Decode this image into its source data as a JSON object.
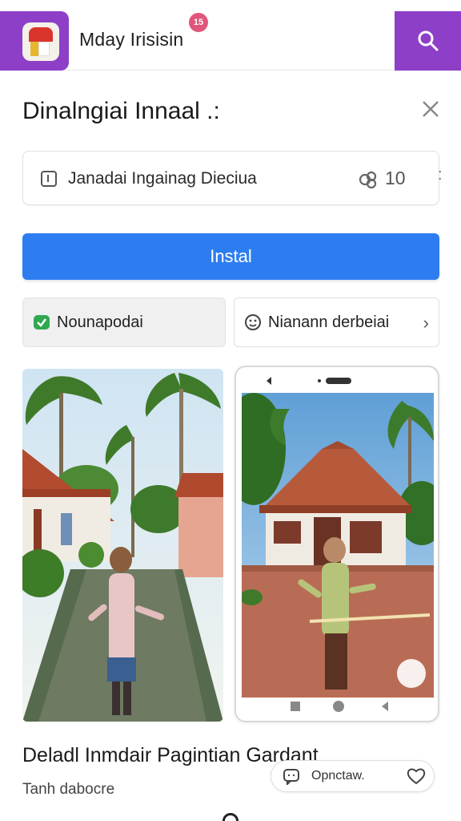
{
  "header": {
    "app_title": "Mday Irisisin",
    "badge_count": "15",
    "search_icon": "search-icon"
  },
  "page": {
    "title": "Dinalngiai Innaal .:",
    "close_icon": "close-icon"
  },
  "info_card": {
    "text": "Janadai Ingainag Dieciua",
    "rating": "10",
    "icon": "info-icon"
  },
  "install": {
    "label": "Instal"
  },
  "chips": {
    "left": {
      "label": "Nounapodai",
      "icon": "check-badge-icon"
    },
    "right": {
      "label": "Nianann derbeiai",
      "icon": "emoji-icon",
      "arrow": "›"
    }
  },
  "section": {
    "title": "Deladl Inmdair  Pagintian Gardant",
    "subtitle": "Tanh dabocre"
  },
  "comment_pill": {
    "label": "Opnctaw.",
    "icon": "comment-icon",
    "heart": "heart-icon"
  },
  "colors": {
    "accent_purple": "#8e3fc8",
    "install_blue": "#2d7df0",
    "badge_pink": "#e0567a"
  }
}
